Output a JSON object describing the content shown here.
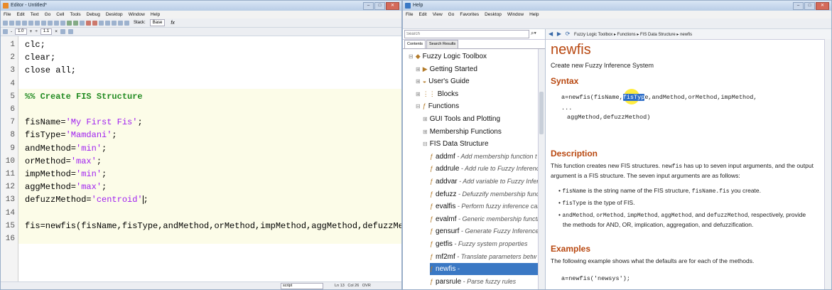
{
  "editor": {
    "title": "Editor - Untitled*",
    "menu": [
      "File",
      "Edit",
      "Text",
      "Go",
      "Cell",
      "Tools",
      "Debug",
      "Desktop",
      "Window",
      "Help"
    ],
    "stack_label": "Stack:",
    "stack_value": "Base",
    "fx_label": "fx",
    "cell_toolbar": {
      "minus_value": "1.0",
      "plus_value": "1.1",
      "plus_sign": "+",
      "minus_sign": "-",
      "divide_sign": "÷",
      "times_sign": "×"
    },
    "lines": [
      {
        "num": "1",
        "parts": [
          {
            "t": "clc;",
            "c": "n"
          }
        ]
      },
      {
        "num": "2",
        "parts": [
          {
            "t": "clear;",
            "c": "n"
          }
        ]
      },
      {
        "num": "3",
        "parts": [
          {
            "t": "close all;",
            "c": "n"
          }
        ]
      },
      {
        "num": "4",
        "parts": []
      },
      {
        "num": "5",
        "parts": [
          {
            "t": "%% Create FIS Structure",
            "c": "cmt"
          }
        ]
      },
      {
        "num": "6",
        "parts": []
      },
      {
        "num": "7",
        "parts": [
          {
            "t": "fisName=",
            "c": "n"
          },
          {
            "t": "'My First Fis'",
            "c": "str"
          },
          {
            "t": ";",
            "c": "n"
          }
        ]
      },
      {
        "num": "8",
        "parts": [
          {
            "t": "fisType=",
            "c": "n"
          },
          {
            "t": "'Mamdani'",
            "c": "str"
          },
          {
            "t": ";",
            "c": "n"
          }
        ]
      },
      {
        "num": "9",
        "parts": [
          {
            "t": "andMethod=",
            "c": "n"
          },
          {
            "t": "'min'",
            "c": "str"
          },
          {
            "t": ";",
            "c": "n"
          }
        ]
      },
      {
        "num": "10",
        "parts": [
          {
            "t": "orMethod=",
            "c": "n"
          },
          {
            "t": "'max'",
            "c": "str"
          },
          {
            "t": ";",
            "c": "n"
          }
        ]
      },
      {
        "num": "11",
        "parts": [
          {
            "t": "impMethod=",
            "c": "n"
          },
          {
            "t": "'min'",
            "c": "str"
          },
          {
            "t": ";",
            "c": "n"
          }
        ]
      },
      {
        "num": "12",
        "parts": [
          {
            "t": "aggMethod=",
            "c": "n"
          },
          {
            "t": "'max'",
            "c": "str"
          },
          {
            "t": ";",
            "c": "n"
          }
        ]
      },
      {
        "num": "13",
        "parts": [
          {
            "t": "defuzzMethod=",
            "c": "n"
          },
          {
            "t": "'centroid'",
            "c": "str"
          },
          {
            "t": "|",
            "c": "cursor"
          },
          {
            "t": ";",
            "c": "n"
          }
        ]
      },
      {
        "num": "14",
        "parts": []
      },
      {
        "num": "15",
        "parts": [
          {
            "t": "fis=newfis(fisName,fisType,andMethod,orMethod,impMethod,aggMethod,defuzzMethod);",
            "c": "n"
          }
        ]
      },
      {
        "num": "16",
        "parts": []
      }
    ],
    "status": {
      "mode": "script",
      "ln_label": "Ln",
      "ln": "13",
      "col_label": "Col",
      "col": "26",
      "ovr": "OVR"
    }
  },
  "help": {
    "title": "Help",
    "menu": [
      "File",
      "Edit",
      "View",
      "Go",
      "Favorites",
      "Desktop",
      "Window",
      "Help"
    ],
    "search_placeholder": "Search",
    "tabs": [
      "Contents",
      "Search Results"
    ],
    "breadcrumb": [
      "Fuzzy Logic Toolbox",
      "Functions",
      "FIS Data Structure",
      "newfis"
    ],
    "tree": [
      {
        "label": "Fuzzy Logic Toolbox",
        "desc": "",
        "indent": 0,
        "exp": "⊟",
        "icon": "◆",
        "icon_name": "toolbox-icon"
      },
      {
        "label": "Getting Started",
        "desc": "",
        "indent": 1,
        "exp": "⊞",
        "icon": "▶",
        "icon_name": "play-icon"
      },
      {
        "label": "User's Guide",
        "desc": "",
        "indent": 1,
        "exp": "⊞",
        "icon": "◒",
        "icon_name": "guide-icon"
      },
      {
        "label": "Blocks",
        "desc": "",
        "indent": 1,
        "exp": "⊞",
        "icon": "⋮⋮",
        "icon_name": "blocks-icon"
      },
      {
        "label": "Functions",
        "desc": "",
        "indent": 1,
        "exp": "⊟",
        "icon": "ƒ",
        "icon_name": "function-icon"
      },
      {
        "label": "GUI Tools and Plotting",
        "desc": "",
        "indent": 2,
        "exp": "⊞",
        "icon": "",
        "icon_name": ""
      },
      {
        "label": "Membership Functions",
        "desc": "",
        "indent": 2,
        "exp": "⊞",
        "icon": "",
        "icon_name": ""
      },
      {
        "label": "FIS Data Structure",
        "desc": "",
        "indent": 2,
        "exp": "⊟",
        "icon": "",
        "icon_name": ""
      },
      {
        "label": "addmf",
        "desc": " - Add membership function t",
        "indent": 3,
        "exp": "",
        "icon": "ƒ",
        "icon_name": "function-icon"
      },
      {
        "label": "addrule",
        "desc": " - Add rule to Fuzzy Inferenc",
        "indent": 3,
        "exp": "",
        "icon": "ƒ",
        "icon_name": "function-icon"
      },
      {
        "label": "addvar",
        "desc": " - Add variable to Fuzzy Infer",
        "indent": 3,
        "exp": "",
        "icon": "ƒ",
        "icon_name": "function-icon"
      },
      {
        "label": "defuzz",
        "desc": " - Defuzzify membership func",
        "indent": 3,
        "exp": "",
        "icon": "ƒ",
        "icon_name": "function-icon"
      },
      {
        "label": "evalfis",
        "desc": " - Perform fuzzy inference cal",
        "indent": 3,
        "exp": "",
        "icon": "ƒ",
        "icon_name": "function-icon"
      },
      {
        "label": "evalmf",
        "desc": " - Generic membership functi",
        "indent": 3,
        "exp": "",
        "icon": "ƒ",
        "icon_name": "function-icon"
      },
      {
        "label": "gensurf",
        "desc": " - Generate Fuzzy Inference",
        "indent": 3,
        "exp": "",
        "icon": "ƒ",
        "icon_name": "function-icon"
      },
      {
        "label": "getfis",
        "desc": " - Fuzzy system properties",
        "indent": 3,
        "exp": "",
        "icon": "ƒ",
        "icon_name": "function-icon"
      },
      {
        "label": "mf2mf",
        "desc": " - Translate parameters betw",
        "indent": 3,
        "exp": "",
        "icon": "ƒ",
        "icon_name": "function-icon"
      },
      {
        "label": "newfis",
        "desc": " -",
        "indent": 3,
        "exp": "",
        "icon": "ƒ",
        "icon_name": "function-icon",
        "selected": true
      },
      {
        "label": "parsrule",
        "desc": " - Parse fuzzy rules",
        "indent": 3,
        "exp": "",
        "icon": "ƒ",
        "icon_name": "function-icon"
      }
    ],
    "doc": {
      "title": "newfis",
      "subtitle": "Create new Fuzzy Inference System",
      "syntax_h": "Syntax",
      "syntax_pre": "a=newfis(fisName,",
      "syntax_hl": "fisTyp",
      "syntax_post": "e,andMethod,orMethod,impMethod,",
      "syntax_line2": "...",
      "syntax_line3": "aggMethod,defuzzMethod)",
      "desc_h": "Description",
      "desc_p1a": "This function creates new FIS structures. ",
      "desc_p1code": "newfis",
      "desc_p1b": " has up to seven input arguments, and the output",
      "desc_p2": "argument is a FIS structure. The seven input arguments are as follows:",
      "b1a": "fisName",
      "b1b": " is the string name of the FIS structure, ",
      "b1c": "fisName.fis",
      "b1d": " you create.",
      "b2a": "fisType",
      "b2b": " is the type of FIS.",
      "b3a": "andMethod",
      "b3b": ", ",
      "b3c": "orMethod",
      "b3d": ", ",
      "b3e": "impMethod",
      "b3f": ", ",
      "b3g": "aggMethod",
      "b3h": ", and ",
      "b3i": "defuzzMethod",
      "b3j": ", respectively, provide",
      "b3k": "the methods for AND, OR, implication, aggregation, and defuzzification.",
      "ex_h": "Examples",
      "ex_p": "The following example shows what the defaults are for each of the methods.",
      "ex_code": "a=newfis('newsys');"
    }
  }
}
